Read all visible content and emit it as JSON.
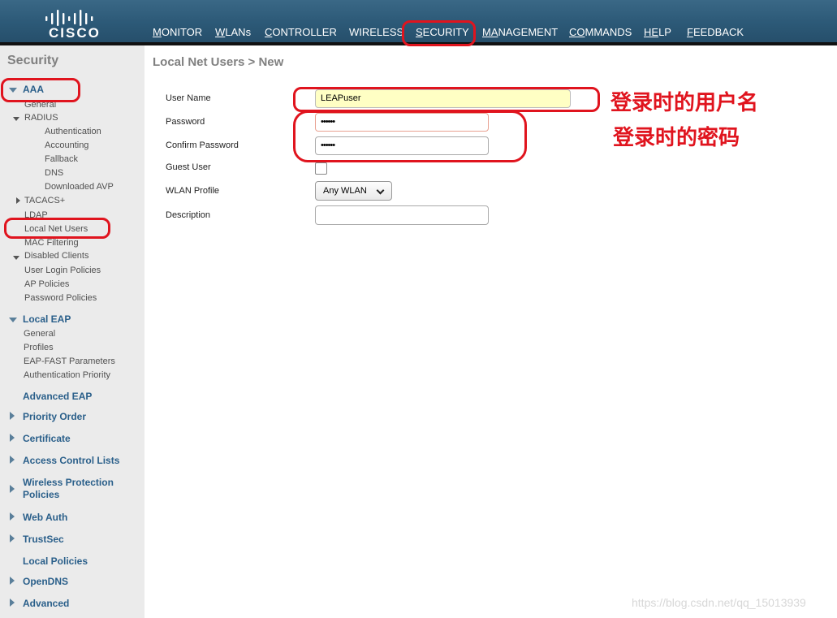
{
  "brand": {
    "name": "cisco"
  },
  "nav": [
    {
      "label": "MONITOR",
      "ul": "M",
      "rest": "ONITOR"
    },
    {
      "label": "WLANs",
      "ul": "W",
      "rest": "LANs"
    },
    {
      "label": "CONTROLLER",
      "ul": "C",
      "rest": "ONTROLLER"
    },
    {
      "label": "WIRELESS",
      "ul": "",
      "rest": "WIRELESS"
    },
    {
      "label": "SECURITY",
      "ul": "S",
      "rest": "ECURITY",
      "active": true
    },
    {
      "label": "MANAGEMENT",
      "ul": "MA",
      "rest": "NAGEMENT"
    },
    {
      "label": "COMMANDS",
      "ul": "CO",
      "rest": "MMANDS"
    },
    {
      "label": "HELP",
      "ul": "HE",
      "rest": "LP"
    },
    {
      "label": "FEEDBACK",
      "ul": "F",
      "rest": "EEDBACK"
    }
  ],
  "sidebar": {
    "title": "Security",
    "aaa": {
      "label": "AAA",
      "general": "General",
      "radius": {
        "label": "RADIUS",
        "items": [
          "Authentication",
          "Accounting",
          "Fallback",
          "DNS",
          "Downloaded AVP"
        ]
      },
      "tacacs": "TACACS+",
      "ldap": "LDAP",
      "local_net_users": "Local Net Users",
      "mac_filtering": "MAC Filtering",
      "disabled_clients": "Disabled Clients",
      "user_login_policies": "User Login Policies",
      "ap_policies": "AP Policies",
      "password_policies": "Password Policies"
    },
    "local_eap": {
      "label": "Local EAP",
      "items": [
        "General",
        "Profiles",
        "EAP-FAST Parameters",
        "Authentication Priority"
      ]
    },
    "sections": {
      "advanced_eap": "Advanced EAP",
      "priority_order": "Priority Order",
      "certificate": "Certificate",
      "acl": "Access Control Lists",
      "wpp_line1": "Wireless Protection",
      "wpp_line2": "Policies",
      "web_auth": "Web Auth",
      "trustsec": "TrustSec",
      "local_policies": "Local Policies",
      "opendns": "OpenDNS",
      "advanced": "Advanced"
    }
  },
  "main": {
    "title": "Local Net Users > New",
    "fields": {
      "user_name_label": "User Name",
      "user_name_value": "LEAPuser",
      "password_label": "Password",
      "password_value": "••••••",
      "confirm_label": "Confirm Password",
      "confirm_value": "••••••",
      "guest_label": "Guest User",
      "guest_checked": false,
      "wlan_label": "WLAN Profile",
      "wlan_value": "Any WLAN",
      "description_label": "Description",
      "description_value": ""
    }
  },
  "annotations": {
    "username_note": "登录时的用户名",
    "password_note": "登录时的密码",
    "color": "#e0141e"
  },
  "watermark": "https://blog.csdn.net/qq_15013939"
}
